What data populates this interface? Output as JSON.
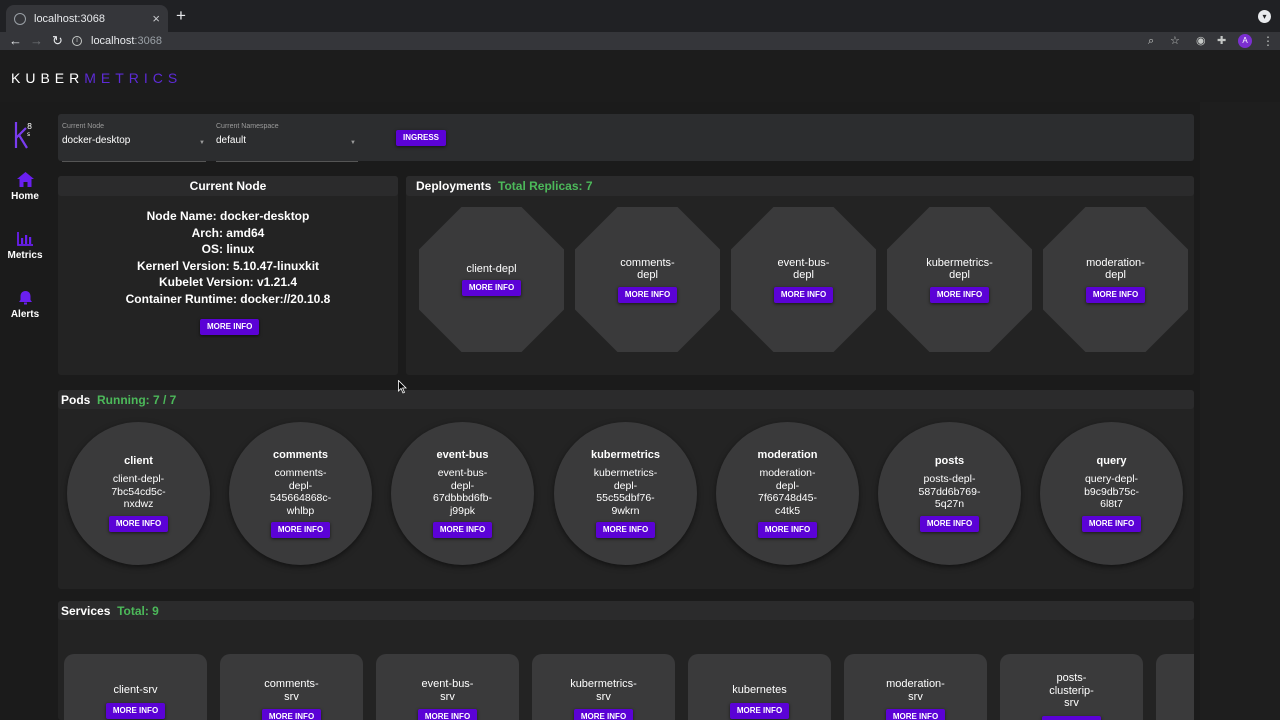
{
  "browser": {
    "tab_title": "localhost:3068",
    "tab_close": "×",
    "new_tab": "+",
    "back": "←",
    "forward": "→",
    "reload": "↻",
    "url_host": "localhost",
    "url_port": ":3068",
    "profile_initial": "A"
  },
  "app": {
    "logo_part1": "KUBER",
    "logo_part2": "METRICS",
    "accent_color": "#5b02d6",
    "status_color": "#4cb95a"
  },
  "sidebar": {
    "items": [
      {
        "label": "Home",
        "icon": "home-icon"
      },
      {
        "label": "Metrics",
        "icon": "bar-chart-icon"
      },
      {
        "label": "Alerts",
        "icon": "bell-icon"
      }
    ]
  },
  "selectors": {
    "node_label": "Current Node",
    "node_value": "docker-desktop",
    "namespace_label": "Current Namespace",
    "namespace_value": "default",
    "ingress_button": "INGRESS"
  },
  "current_node": {
    "title": "Current Node",
    "lines": [
      "Node Name: docker-desktop",
      "Arch: amd64",
      "OS: linux",
      "Kernerl Version: 5.10.47-linuxkit",
      "Kubelet Version: v1.21.4",
      "Container Runtime: docker://20.10.8"
    ],
    "button": "MORE INFO"
  },
  "deployments": {
    "title": "Deployments",
    "summary": "Total Replicas: 7",
    "button": "MORE INFO",
    "items": [
      "client-depl",
      "comments-\ndepl",
      "event-bus-\ndepl",
      "kubermetrics-\ndepl",
      "moderation-\ndepl"
    ]
  },
  "pods": {
    "title": "Pods",
    "summary": "Running: 7 / 7",
    "button": "MORE INFO",
    "items": [
      {
        "name": "client",
        "id": "client-depl-\n7bc54cd5c-\nnxdwz"
      },
      {
        "name": "comments",
        "id": "comments-\ndepl-\n545664868c-\nwhlbp"
      },
      {
        "name": "event-bus",
        "id": "event-bus-\ndepl-\n67dbbbd6fb-\nj99pk"
      },
      {
        "name": "kubermetrics",
        "id": "kubermetrics-\ndepl-\n55c55dbf76-\n9wkrn"
      },
      {
        "name": "moderation",
        "id": "moderation-\ndepl-\n7f66748d45-\nc4tk5"
      },
      {
        "name": "posts",
        "id": "posts-depl-\n587dd6b769-\n5q27n"
      },
      {
        "name": "query",
        "id": "query-depl-\nb9c9db75c-\n6l8t7"
      }
    ]
  },
  "services": {
    "title": "Services",
    "summary": "Total: 9",
    "button": "MORE INFO",
    "items": [
      "client-srv",
      "comments-\nsrv",
      "event-bus-\nsrv",
      "kubermetrics-\nsrv",
      "kubernetes",
      "moderation-\nsrv",
      "posts-\nclusterip-\nsrv"
    ]
  }
}
